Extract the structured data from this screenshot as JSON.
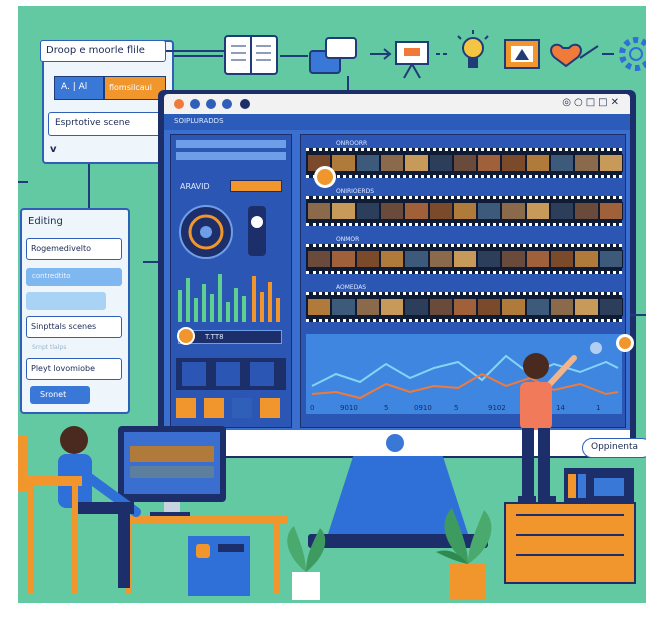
{
  "left_panel": {
    "drop_label": "Droop e moorle flile",
    "tab_ai": "A. | Al",
    "tab_other": "flomsilcaui",
    "scene_field": "Esprtotive scene",
    "chevron": "v"
  },
  "editing_panel": {
    "title": "Editing",
    "items": [
      "Rogemedivelto",
      "Sinpttals scenes",
      "Pleyt lovomiobe"
    ],
    "faded_items": [
      "contredtito",
      "Srnpt tlalps"
    ],
    "button": "Sronet"
  },
  "monitor": {
    "window_header": "SOIPLURADDS",
    "panel_title": "ARAVID",
    "timeline_ruler": [
      "0",
      "9010",
      "5",
      "0910",
      "5",
      "9102",
      "14",
      "1"
    ],
    "strip_labels": [
      "ONROORR",
      "ONIRIOERDS",
      "ONMOR",
      "AOMEDAS"
    ],
    "meter_value": "T.TT8",
    "tool_icons": [
      "pen-icon",
      "scissors-icon",
      "connector-icon",
      "shape-icon"
    ]
  },
  "right_label": "Oppinenta",
  "colors": {
    "background": "#62c9a3",
    "panel_blue": "#2f5fb8",
    "dark_blue": "#1c2f6b",
    "accent_orange": "#f0962d",
    "line_orange": "#f07a3a"
  }
}
